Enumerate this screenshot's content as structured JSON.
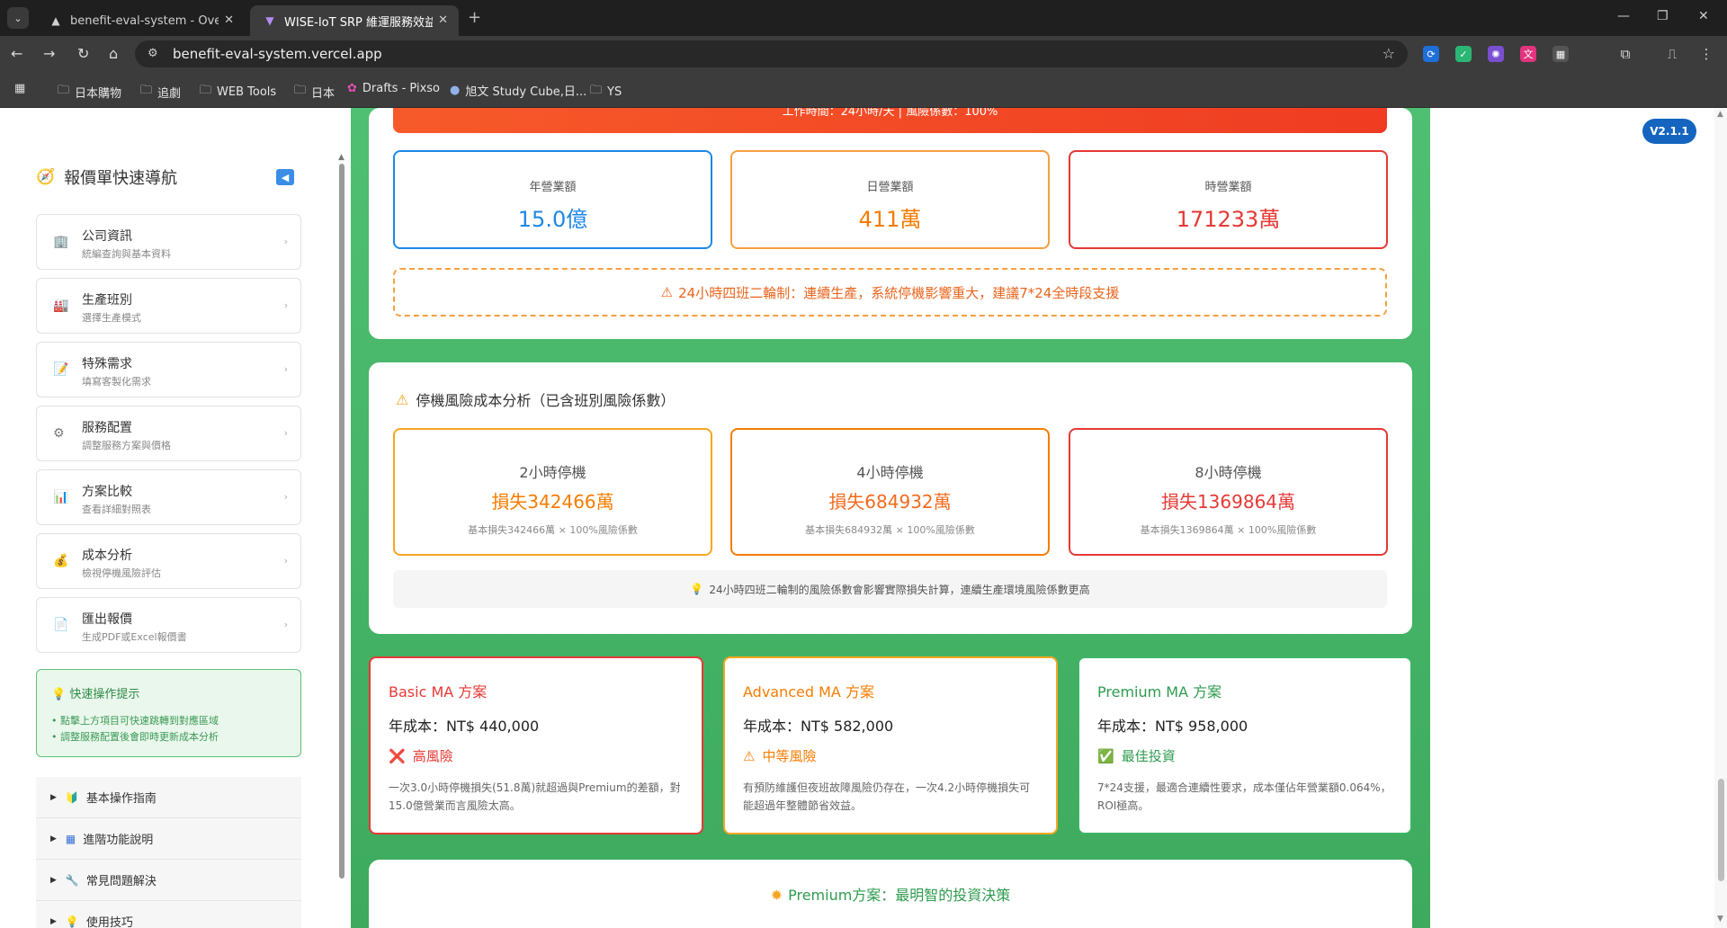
{
  "browser": {
    "tabs": [
      {
        "title": "benefit-eval-system - Overvie",
        "icon": "vercel-triangle-icon"
      },
      {
        "title": "WISE-IoT SRP 維運服務效益評",
        "icon": "vite-icon"
      }
    ],
    "url": "benefit-eval-system.vercel.app",
    "bookmarks": [
      "日本購物",
      "追劇",
      "WEB Tools",
      "日本",
      "Drafts - Pixso",
      "旭文 Study Cube,日...",
      "YS"
    ]
  },
  "version_badge": "V2.1.1",
  "sidebar": {
    "title": "報價單快速導航",
    "items": [
      {
        "label": "公司資訊",
        "sub": "統編查詢與基本資料",
        "icon": "🏢"
      },
      {
        "label": "生產班別",
        "sub": "選擇生產模式",
        "icon": "🏭"
      },
      {
        "label": "特殊需求",
        "sub": "填寫客製化需求",
        "icon": "📝"
      },
      {
        "label": "服務配置",
        "sub": "調整服務方案與價格",
        "icon": "⚙"
      },
      {
        "label": "方案比較",
        "sub": "查看詳細對照表",
        "icon": "📊"
      },
      {
        "label": "成本分析",
        "sub": "檢視停機風險評估",
        "icon": "💰"
      },
      {
        "label": "匯出報價",
        "sub": "生成PDF或Excel報價書",
        "icon": "📄"
      }
    ],
    "tips": {
      "title": "快速操作提示",
      "lines": [
        "• 點擊上方項目可快速跳轉到對應區域",
        "• 調整服務配置後會即時更新成本分析"
      ]
    },
    "accordion": [
      {
        "label": "基本操作指南",
        "icon": "🔰"
      },
      {
        "label": "進階功能說明",
        "icon": "▦"
      },
      {
        "label": "常見問題解決",
        "icon": "🔧"
      },
      {
        "label": "使用技巧",
        "icon": "💡"
      }
    ]
  },
  "banner_text": "工作時間：24小時/天 | 風險係數：100%",
  "revenue": [
    {
      "label": "年營業額",
      "value": "15.0億",
      "color": "#1e88e5"
    },
    {
      "label": "日營業額",
      "value": "411萬",
      "color": "#f57c00"
    },
    {
      "label": "時營業額",
      "value": "171233萬",
      "color": "#e53935"
    }
  ],
  "shift_warning": "24小時四班二輪制：連續生產，系統停機影響重大，建議7*24全時段支援",
  "downtime": {
    "title": "停機風險成本分析（已含班別風險係數）",
    "cards": [
      {
        "label": "2小時停機",
        "loss": "損失342466萬",
        "note": "基本損失342466萬 × 100%風險係數",
        "color": "#f5a623",
        "text_color": "#f57c00"
      },
      {
        "label": "4小時停機",
        "loss": "損失684932萬",
        "note": "基本損失684932萬 × 100%風險係數",
        "color": "#f57c00",
        "text_color": "#f26b1d"
      },
      {
        "label": "8小時停機",
        "loss": "損失1369864萬",
        "note": "基本損失1369864萬 × 100%風險係數",
        "color": "#e53935",
        "text_color": "#e53935"
      }
    ],
    "hint": "24小時四班二輪制的風險係數會影響實際損失計算，連續生產環境風險係數更高"
  },
  "plans": [
    {
      "name": "Basic MA 方案",
      "cost": "年成本：NT$ 440,000",
      "risk": "高風險",
      "risk_icon": "❌",
      "desc": "一次3.0小時停機損失(51.8萬)就超過與Premium的差額，對15.0億營業而言風險太高。",
      "color": "#e53935"
    },
    {
      "name": "Advanced MA 方案",
      "cost": "年成本：NT$ 582,000",
      "risk": "中等風險",
      "risk_icon": "⚠",
      "desc": "有預防維護但夜班故障風險仍存在，一次4.2小時停機損失可能超過年整體節省效益。",
      "color": "#f57c00"
    },
    {
      "name": "Premium MA 方案",
      "cost": "年成本：NT$ 958,000",
      "risk": "最佳投資",
      "risk_icon": "✅",
      "desc": "7*24支援，最適合連續性要求，成本僅佔年營業額0.064%，ROI極高。",
      "color": "#2e9b4f"
    }
  ],
  "decision_title": "Premium方案：最明智的投資決策"
}
